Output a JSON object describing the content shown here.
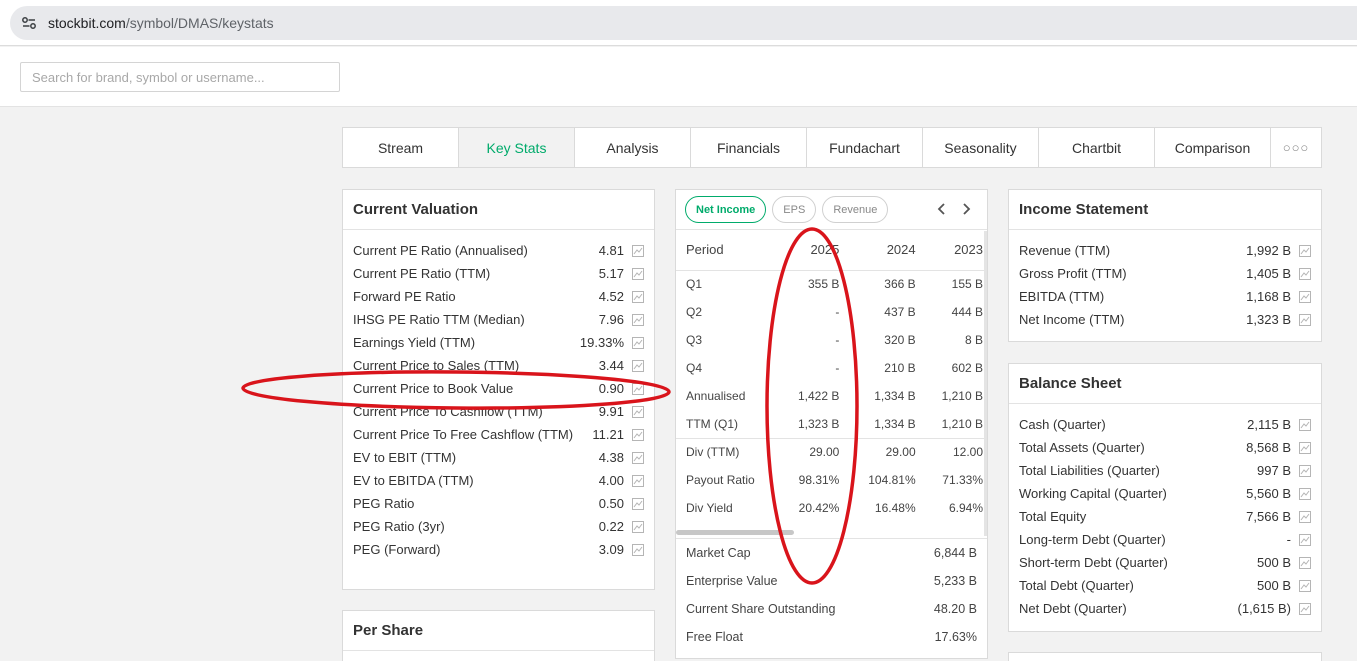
{
  "browser": {
    "url_host": "stockbit.com",
    "url_path": "/symbol/DMAS/keystats"
  },
  "search": {
    "placeholder": "Search for brand, symbol or username..."
  },
  "tabs": [
    {
      "label": "Stream"
    },
    {
      "label": "Key Stats",
      "active": true
    },
    {
      "label": "Analysis"
    },
    {
      "label": "Financials"
    },
    {
      "label": "Fundachart"
    },
    {
      "label": "Seasonality"
    },
    {
      "label": "Chartbit"
    },
    {
      "label": "Comparison"
    },
    {
      "label": "○○○"
    }
  ],
  "valuation": {
    "title": "Current Valuation",
    "rows": [
      {
        "label": "Current PE Ratio (Annualised)",
        "value": "4.81"
      },
      {
        "label": "Current PE Ratio (TTM)",
        "value": "5.17"
      },
      {
        "label": "Forward PE Ratio",
        "value": "4.52"
      },
      {
        "label": "IHSG PE Ratio TTM (Median)",
        "value": "7.96"
      },
      {
        "label": "Earnings Yield (TTM)",
        "value": "19.33%"
      },
      {
        "label": "Current Price to Sales (TTM)",
        "value": "3.44"
      },
      {
        "label": "Current Price to Book Value",
        "value": "0.90"
      },
      {
        "label": "Current Price To Cashflow (TTM)",
        "value": "9.91"
      },
      {
        "label": "Current Price To Free Cashflow (TTM)",
        "value": "11.21"
      },
      {
        "label": "EV to EBIT (TTM)",
        "value": "4.38"
      },
      {
        "label": "EV to EBITDA (TTM)",
        "value": "4.00"
      },
      {
        "label": "PEG Ratio",
        "value": "0.50"
      },
      {
        "label": "PEG Ratio (3yr)",
        "value": "0.22"
      },
      {
        "label": "PEG (Forward)",
        "value": "3.09"
      }
    ]
  },
  "per_share": {
    "title": "Per Share"
  },
  "period_table": {
    "pills": [
      "Net Income",
      "EPS",
      "Revenue"
    ],
    "arrow_prev": "‹",
    "arrow_next": "›",
    "header": [
      "Period",
      "2025",
      "2024",
      "2023"
    ],
    "rows": [
      [
        "Q1",
        "355 B",
        "366 B",
        "155 B"
      ],
      [
        "Q2",
        "-",
        "437 B",
        "444 B"
      ],
      [
        "Q3",
        "-",
        "320 B",
        "8 B"
      ],
      [
        "Q4",
        "-",
        "210 B",
        "602 B"
      ],
      [
        "Annualised",
        "1,422 B",
        "1,334 B",
        "1,210 B"
      ],
      [
        "TTM (Q1)",
        "1,323 B",
        "1,334 B",
        "1,210 B"
      ],
      [
        "Div (TTM)",
        "29.00",
        "29.00",
        "12.00"
      ],
      [
        "Payout Ratio",
        "98.31%",
        "104.81%",
        "71.33%"
      ],
      [
        "Div Yield",
        "20.42%",
        "16.48%",
        "6.94%"
      ]
    ],
    "market": [
      {
        "label": "Market Cap",
        "value": "6,844 B"
      },
      {
        "label": "Enterprise Value",
        "value": "5,233 B"
      },
      {
        "label": "Current Share Outstanding",
        "value": "48.20 B"
      },
      {
        "label": "Free Float",
        "value": "17.63%"
      }
    ]
  },
  "income": {
    "title": "Income Statement",
    "rows": [
      {
        "label": "Revenue (TTM)",
        "value": "1,992 B"
      },
      {
        "label": "Gross Profit (TTM)",
        "value": "1,405 B"
      },
      {
        "label": "EBITDA (TTM)",
        "value": "1,168 B"
      },
      {
        "label": "Net Income (TTM)",
        "value": "1,323 B"
      }
    ]
  },
  "balance": {
    "title": "Balance Sheet",
    "rows": [
      {
        "label": "Cash (Quarter)",
        "value": "2,115 B"
      },
      {
        "label": "Total Assets (Quarter)",
        "value": "8,568 B"
      },
      {
        "label": "Total Liabilities (Quarter)",
        "value": "997 B"
      },
      {
        "label": "Working Capital (Quarter)",
        "value": "5,560 B"
      },
      {
        "label": "Total Equity",
        "value": "7,566 B"
      },
      {
        "label": "Long-term Debt (Quarter)",
        "value": "-"
      },
      {
        "label": "Short-term Debt (Quarter)",
        "value": "500 B"
      },
      {
        "label": "Total Debt (Quarter)",
        "value": "500 B"
      },
      {
        "label": "Net Debt (Quarter)",
        "value": "(1,615 B)"
      }
    ]
  },
  "colors": {
    "accent": "#00ab6b",
    "annotation": "#d9141b"
  },
  "icons": [
    "site-settings-icon",
    "mini-chart-icon",
    "chevron-left-icon",
    "chevron-right-icon"
  ]
}
